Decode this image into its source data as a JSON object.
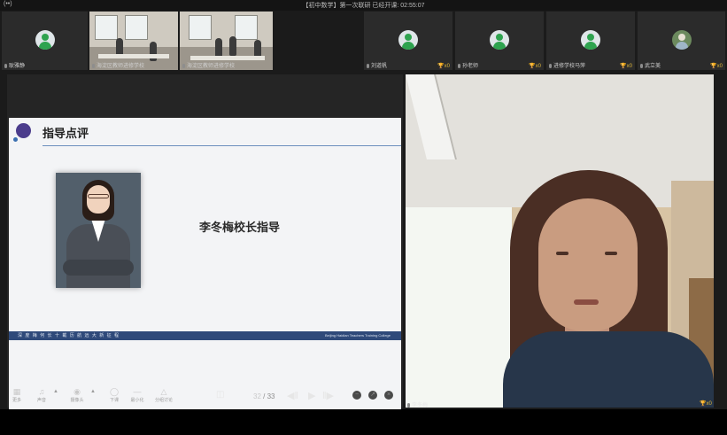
{
  "window": {
    "signal_glyph": "(••)",
    "title": "【初中数学】第一次联研   已经开课: 02:55:07"
  },
  "participants": [
    {
      "name": "耿雅静",
      "badge": ""
    },
    {
      "name": "海淀区教师进修学校",
      "badge": ""
    },
    {
      "name": "海淀区教师进修学校",
      "badge": ""
    },
    {
      "name": "刘道帆",
      "badge": "x0"
    },
    {
      "name": "孙老师",
      "badge": "x0"
    },
    {
      "name": "进修学校马萍",
      "badge": "x0"
    },
    {
      "name": "武立美",
      "badge": "x0"
    }
  ],
  "slide": {
    "title": "指导点评",
    "caption": "李冬梅校长指导",
    "footer_left": "深 度 梅 何 长 十 載  历 航 远 大 新 征 程",
    "footer_right": "Beijing Haidian Teachers Training College"
  },
  "controls": {
    "more": "更多",
    "audio": "声音",
    "camera": "摄像头",
    "lower": "下课",
    "minimize": "最小化",
    "group": "分组讨论",
    "page_current": "32",
    "page_separator": " / ",
    "page_total": "33"
  },
  "camera_feed": {
    "name": "李冬梅",
    "badge": "x0"
  },
  "icons": {
    "mic": "mic-icon",
    "trophy": "trophy-icon",
    "grid": "grid-icon",
    "prev": "previous-icon",
    "play": "play-icon",
    "next": "next-icon"
  }
}
